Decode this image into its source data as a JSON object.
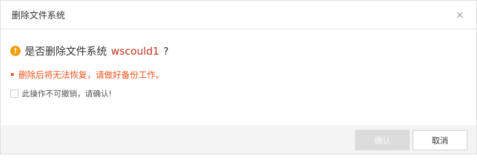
{
  "dialog": {
    "title": "删除文件系统",
    "question_prefix": "是否删除文件系统",
    "filesystem_name": "wscould1",
    "question_suffix": "?",
    "warning_glyph": "!",
    "notice": "删除后将无法恢复，请做好备份工作。",
    "confirm_label": "此操作不可撤销，请确认!",
    "confirm_checked": false,
    "ok_label": "确认",
    "ok_disabled": true,
    "cancel_label": "取消"
  },
  "colors": {
    "warning_icon": "#ef9f0c",
    "filesystem_name": "#c0301e",
    "notice": "#f0551e",
    "disabled_button": "#dcdcdc",
    "footer": "#f4f4f4"
  },
  "icons": {
    "close": "close-icon",
    "warning": "warning-icon",
    "checkbox": "checkbox-icon"
  }
}
